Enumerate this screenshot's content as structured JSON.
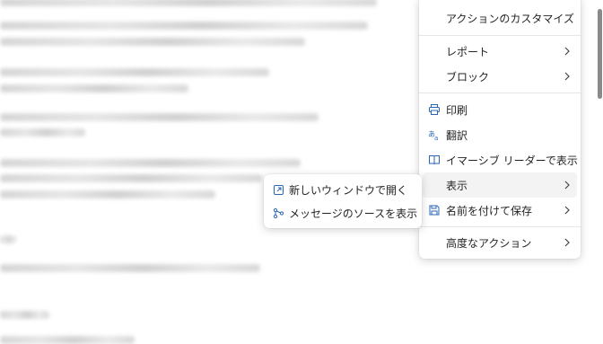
{
  "menu": {
    "items": [
      {
        "label": "アクションのカスタマイズ",
        "icon": "",
        "chevron": false
      },
      {
        "label": "レポート",
        "icon": "",
        "chevron": true
      },
      {
        "label": "ブロック",
        "icon": "",
        "chevron": true
      },
      {
        "label": "印刷",
        "icon": "print-icon",
        "chevron": false
      },
      {
        "label": "翻訳",
        "icon": "translate-icon",
        "chevron": false
      },
      {
        "label": "イマーシブ リーダーで表示",
        "icon": "immersive-reader-icon",
        "chevron": false
      },
      {
        "label": "表示",
        "icon": "",
        "chevron": true,
        "highlighted": true
      },
      {
        "label": "名前を付けて保存",
        "icon": "save-icon",
        "chevron": true
      },
      {
        "label": "高度なアクション",
        "icon": "",
        "chevron": true
      }
    ]
  },
  "submenu": {
    "items": [
      {
        "label": "新しいウィンドウで開く",
        "icon": "open-new-window-icon"
      },
      {
        "label": "メッセージのソースを表示",
        "icon": "view-source-icon"
      }
    ]
  },
  "colors": {
    "icon_blue": "#2b66b5",
    "hover_bg": "#f3f3f3",
    "text": "#242424"
  }
}
